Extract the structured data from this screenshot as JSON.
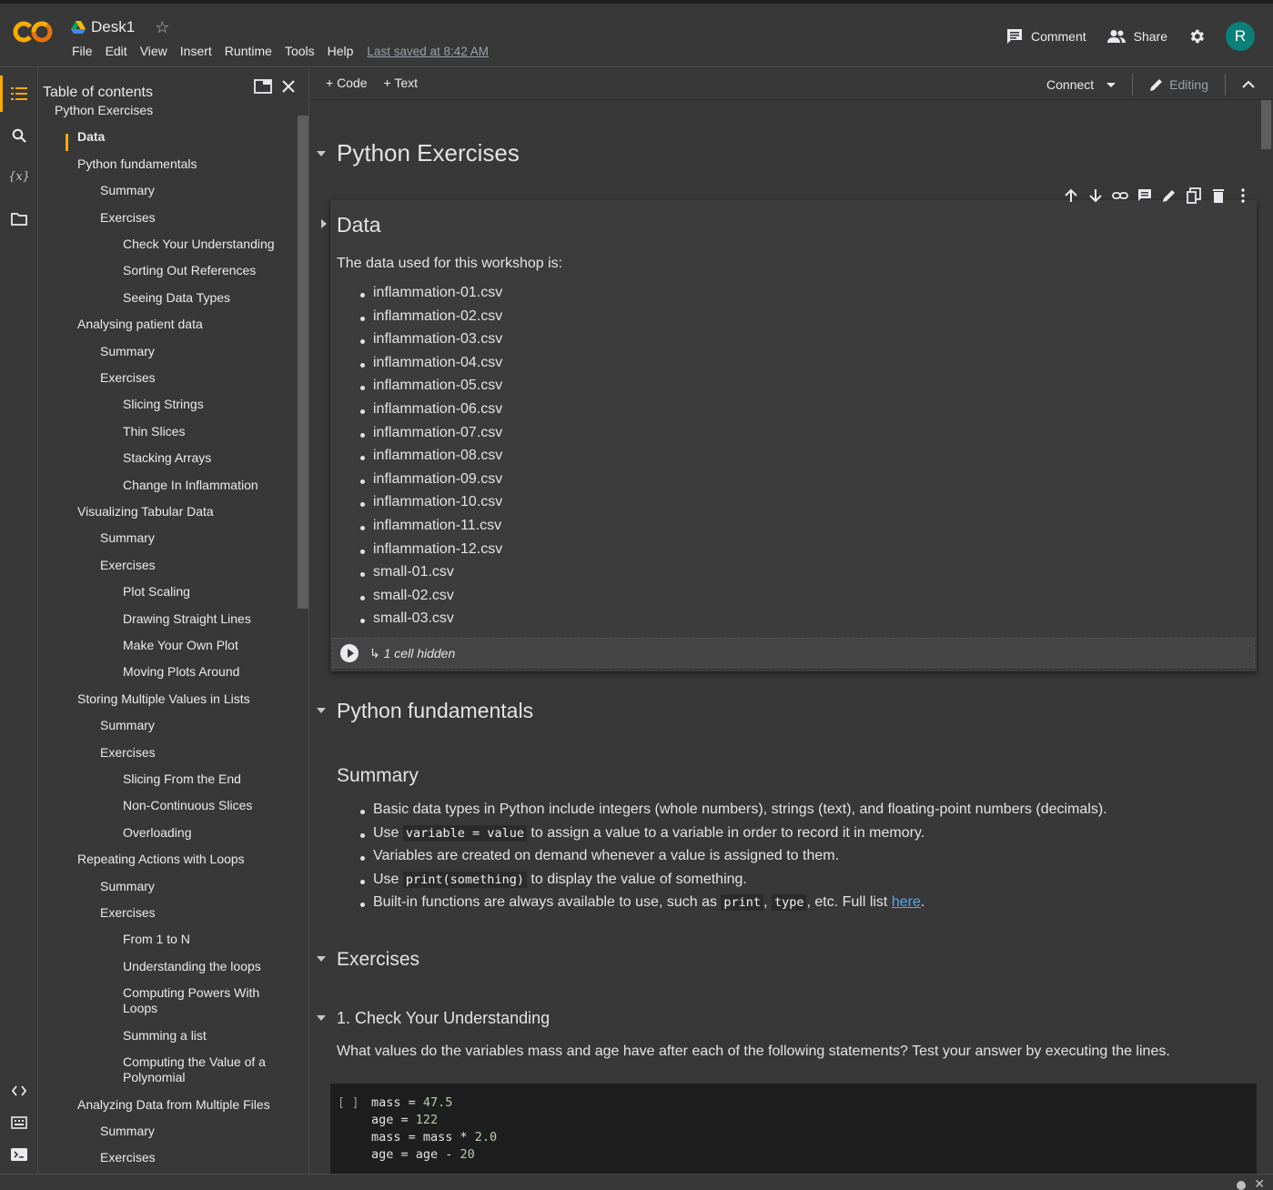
{
  "header": {
    "title": "Desk1",
    "menu": [
      "File",
      "Edit",
      "View",
      "Insert",
      "Runtime",
      "Tools",
      "Help"
    ],
    "last_saved": "Last saved at 8:42 AM",
    "comment_label": "Comment",
    "share_label": "Share",
    "avatar_letter": "R",
    "avatar_color": "#0b8079"
  },
  "toc": {
    "title": "Table of contents",
    "items": [
      {
        "label": "Python Exercises",
        "level": 0
      },
      {
        "label": "Data",
        "level": 1,
        "selected": true
      },
      {
        "label": "Python fundamentals",
        "level": 1
      },
      {
        "label": "Summary",
        "level": 2
      },
      {
        "label": "Exercises",
        "level": 2
      },
      {
        "label": "Check Your Understanding",
        "level": 3
      },
      {
        "label": "Sorting Out References",
        "level": 3
      },
      {
        "label": "Seeing Data Types",
        "level": 3
      },
      {
        "label": "Analysing patient data",
        "level": 1
      },
      {
        "label": "Summary",
        "level": 2
      },
      {
        "label": "Exercises",
        "level": 2
      },
      {
        "label": "Slicing Strings",
        "level": 3
      },
      {
        "label": "Thin Slices",
        "level": 3
      },
      {
        "label": "Stacking Arrays",
        "level": 3
      },
      {
        "label": "Change In Inflammation",
        "level": 3
      },
      {
        "label": "Visualizing Tabular Data",
        "level": 1
      },
      {
        "label": "Summary",
        "level": 2
      },
      {
        "label": "Exercises",
        "level": 2
      },
      {
        "label": "Plot Scaling",
        "level": 3
      },
      {
        "label": "Drawing Straight Lines",
        "level": 3
      },
      {
        "label": "Make Your Own Plot",
        "level": 3
      },
      {
        "label": "Moving Plots Around",
        "level": 3
      },
      {
        "label": "Storing Multiple Values in Lists",
        "level": 1
      },
      {
        "label": "Summary",
        "level": 2
      },
      {
        "label": "Exercises",
        "level": 2
      },
      {
        "label": "Slicing From the End",
        "level": 3
      },
      {
        "label": "Non-Continuous Slices",
        "level": 3
      },
      {
        "label": "Overloading",
        "level": 3
      },
      {
        "label": "Repeating Actions with Loops",
        "level": 1
      },
      {
        "label": "Summary",
        "level": 2
      },
      {
        "label": "Exercises",
        "level": 2
      },
      {
        "label": "From 1 to N",
        "level": 3
      },
      {
        "label": "Understanding the loops",
        "level": 3
      },
      {
        "label": "Computing Powers With Loops",
        "level": 3,
        "lines": 2
      },
      {
        "label": "Summing a list",
        "level": 3
      },
      {
        "label": "Computing the Value of a Polynomial",
        "level": 3,
        "lines": 2
      },
      {
        "label": "Analyzing Data from Multiple Files",
        "level": 1
      },
      {
        "label": "Summary",
        "level": 2
      },
      {
        "label": "Exercises",
        "level": 2
      }
    ]
  },
  "toolbar": {
    "code_label": "+ Code",
    "text_label": "+ Text",
    "connect_label": "Connect",
    "editing_label": "Editing"
  },
  "notebook": {
    "h_python_exercises": "Python Exercises",
    "h_data": "Data",
    "data_intro": "The data used for this workshop is:",
    "files": [
      "inflammation-01.csv",
      "inflammation-02.csv",
      "inflammation-03.csv",
      "inflammation-04.csv",
      "inflammation-05.csv",
      "inflammation-06.csv",
      "inflammation-07.csv",
      "inflammation-08.csv",
      "inflammation-09.csv",
      "inflammation-10.csv",
      "inflammation-11.csv",
      "inflammation-12.csv",
      "small-01.csv",
      "small-02.csv",
      "small-03.csv"
    ],
    "hidden_cells": "↳ 1 cell hidden",
    "h_fundamentals": "Python fundamentals",
    "h_summary": "Summary",
    "summary": {
      "b1": "Basic data types in Python include integers (whole numbers), strings (text), and floating-point numbers (decimals).",
      "b2_pre": "Use ",
      "b2_code": "variable = value",
      "b2_post": " to assign a value to a variable in order to record it in memory.",
      "b3": "Variables are created on demand whenever a value is assigned to them.",
      "b4_pre": "Use ",
      "b4_code": "print(something)",
      "b4_post": " to display the value of something.",
      "b5_pre": "Built-in functions are always available to use, such as ",
      "b5_code1": "print",
      "b5_sep": ", ",
      "b5_code2": "type",
      "b5_mid": ", etc. Full list ",
      "b5_link": "here",
      "b5_end": "."
    },
    "h_exercises": "Exercises",
    "h_check": "1. Check Your Understanding",
    "check_text": "What values do the variables mass and age have after each of the following statements? Test your answer by executing the lines.",
    "code_bracket": "[ ]",
    "code": [
      {
        "pre": "mass = ",
        "num": "47.5"
      },
      {
        "pre": "age = ",
        "num": "122"
      },
      {
        "pre": "mass = mass * ",
        "num": "2.0"
      },
      {
        "pre": "age = age - ",
        "num": "20"
      }
    ]
  }
}
